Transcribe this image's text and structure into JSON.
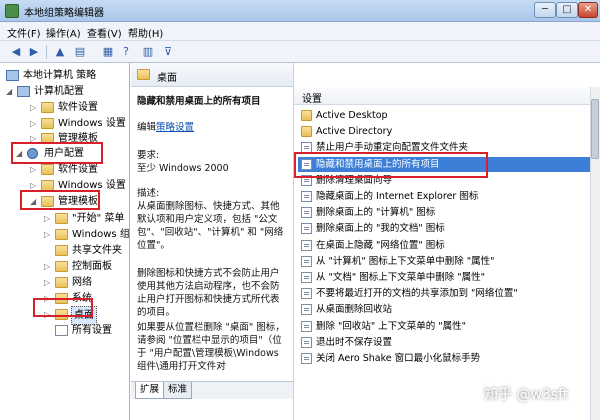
{
  "window": {
    "title": "本地组策略编辑器",
    "min_glyph": "─",
    "max_glyph": "□",
    "close_glyph": "✕"
  },
  "menu": [
    "文件(F)",
    "操作(A)",
    "查看(V)",
    "帮助(H)"
  ],
  "toolbar": {
    "back_icon": "back-arrow-icon",
    "forward_icon": "forward-arrow-icon",
    "glyphs": {
      "back": "◀",
      "forward": "▶",
      "up": "▲",
      "view": "▤",
      "export": "▦",
      "help": "?",
      "properties": "▥",
      "filter": "⊽"
    }
  },
  "tree": {
    "root": "本地计算机 策略",
    "computer_config": "计算机配置",
    "cc_software": "软件设置",
    "cc_windows": "Windows 设置",
    "cc_admin": "管理模板",
    "user_config": "用户配置",
    "uc_software": "软件设置",
    "uc_windows": "Windows 设置",
    "uc_admin": "管理模板",
    "start_menu": "\"开始\" 菜单",
    "windows_components": "Windows 组",
    "shared_folders": "共享文件夹",
    "control_panel": "控制面板",
    "network": "网络",
    "system": "系统",
    "desktop": "桌面",
    "all_settings": "所有设置"
  },
  "desc": {
    "header": "桌面",
    "title": "隐藏和禁用桌面上的所有项目",
    "edit_prefix": "编辑",
    "edit_link": "策略设置",
    "requires_label": "要求:",
    "requires_value": "至少 Windows 2000",
    "description_label": "描述:",
    "para1": "从桌面删除图标、快捷方式、其他默认项和用户定义项，包括 \"公文包\"、\"回收站\"、\"计算机\" 和 \"网络位置\"。",
    "para2": "删除图标和快捷方式不会防止用户使用其他方法启动程序，也不会防止用户打开图标和快捷方式所代表的项目。",
    "para3": "如果要从位置栏删除 \"桌面\" 图标，请参阅 \"位置栏中显示的项目\"（位于 \"用户配置\\管理模板\\Windows 组件\\通用打开文件对"
  },
  "tabs": {
    "extended": "扩展",
    "standard": "标准"
  },
  "list": {
    "header": "设置",
    "rows": [
      "Active Desktop",
      "Active Directory",
      "禁止用户手动重定向配置文件文件夹",
      "隐藏和禁用桌面上的所有项目",
      "删除清理桌面向导",
      "隐藏桌面上的 Internet Explorer 图标",
      "删除桌面上的 \"计算机\" 图标",
      "删除桌面上的 \"我的文档\" 图标",
      "在桌面上隐藏 \"网络位置\" 图标",
      "从 \"计算机\" 图标上下文菜单中删除 \"属性\"",
      "从 \"文档\" 图标上下文菜单中删除 \"属性\"",
      "不要将最近打开的文档的共享添加到 \"网络位置\"",
      "从桌面删除回收站",
      "删除 \"回收站\" 上下文菜单的 \"属性\"",
      "退出时不保存设置",
      "关闭 Aero Shake 窗口最小化鼠标手势"
    ]
  },
  "watermark": "知乎 @w3sft",
  "colors": {
    "highlight_box": "#d8202a",
    "selection": "#3d7fd8",
    "link": "#0b4fb4"
  }
}
